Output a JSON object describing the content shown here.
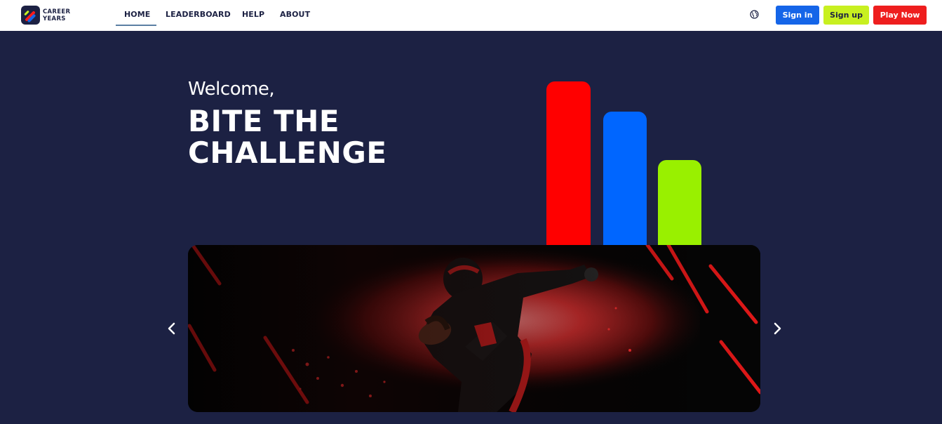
{
  "brand": {
    "line1": "CAREER",
    "line2": "YEARS",
    "colors": {
      "navy": "#1c2143",
      "red": "#ff0000",
      "blue": "#0066ff",
      "green": "#99f000"
    }
  },
  "nav": {
    "home": "HOME",
    "leaderboard": "LEADERBOARD",
    "help": "HELP",
    "about": "ABOUT",
    "active": "HOME"
  },
  "header_actions": {
    "language_icon": "globe-icon",
    "sign_in": "Sign in",
    "sign_up": "Sign up",
    "play_now": "Play Now"
  },
  "hero": {
    "welcome": "Welcome,",
    "headline_line1": "BITE THE",
    "headline_line2": "CHALLENGE"
  },
  "carousel": {
    "slide_subject": "american-football-player",
    "prev_icon": "chevron-left-icon",
    "next_icon": "chevron-right-icon"
  },
  "footer_partial": {
    "text": ""
  }
}
